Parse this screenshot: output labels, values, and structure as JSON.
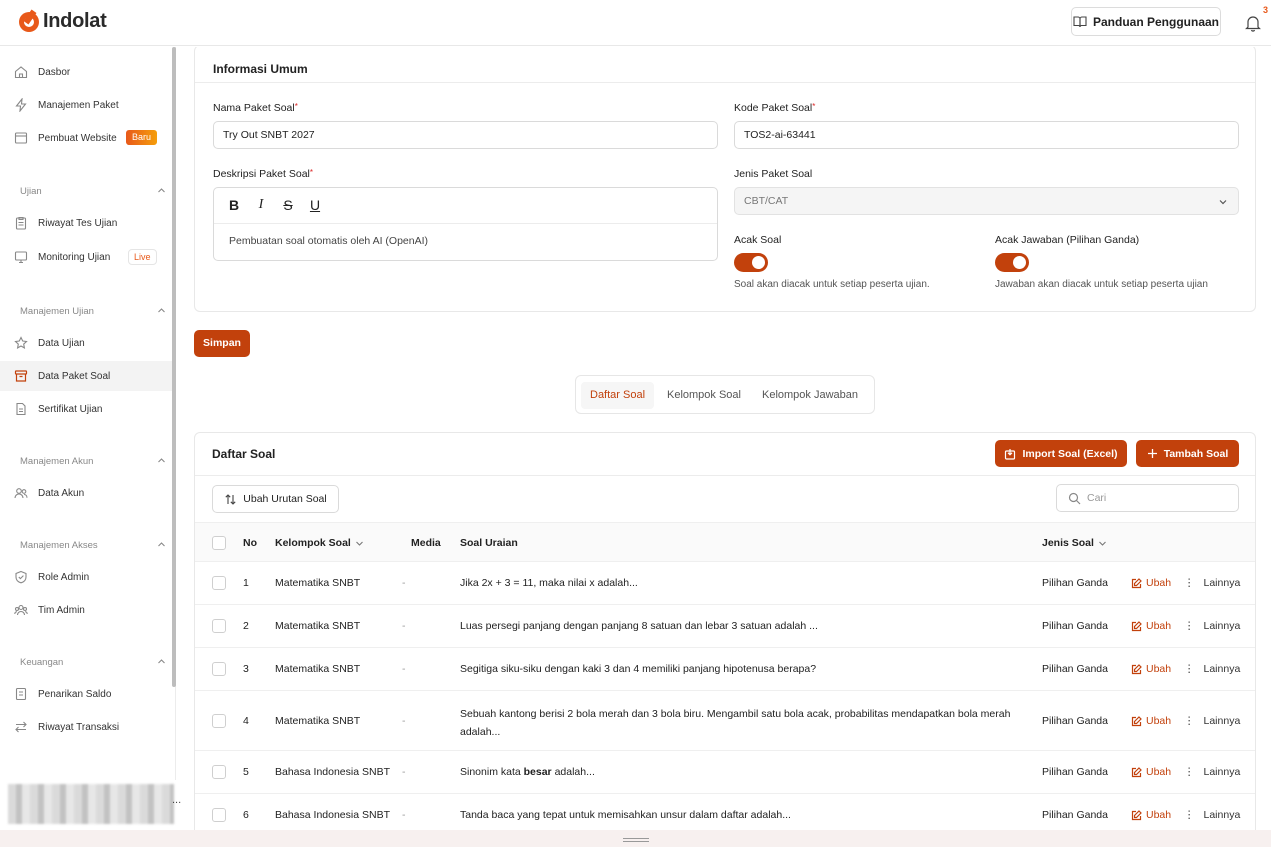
{
  "app": {
    "name": "Indolat"
  },
  "header": {
    "guide_label": "Panduan Penggunaan",
    "notification_count": "3"
  },
  "sidebar": {
    "items": [
      {
        "label": "Dasbor"
      },
      {
        "label": "Manajemen Paket"
      },
      {
        "label": "Pembuat Website",
        "badge": "Baru"
      }
    ],
    "sections": [
      {
        "title": "Ujian",
        "items": [
          {
            "label": "Riwayat Tes Ujian"
          },
          {
            "label": "Monitoring Ujian",
            "badge": "Live"
          }
        ]
      },
      {
        "title": "Manajemen Ujian",
        "items": [
          {
            "label": "Data Ujian"
          },
          {
            "label": "Data Paket Soal"
          },
          {
            "label": "Sertifikat Ujian"
          }
        ]
      },
      {
        "title": "Manajemen Akun",
        "items": [
          {
            "label": "Data Akun"
          }
        ]
      },
      {
        "title": "Manajemen Akses",
        "items": [
          {
            "label": "Role Admin"
          },
          {
            "label": "Tim Admin"
          }
        ]
      },
      {
        "title": "Keuangan",
        "items": [
          {
            "label": "Penarikan Saldo"
          },
          {
            "label": "Riwayat Transaksi"
          }
        ]
      }
    ],
    "active_item": "Data Paket Soal",
    "user_more": "..."
  },
  "form": {
    "title": "Informasi Umum",
    "nama_label": "Nama Paket Soal",
    "nama_value": "Try Out SNBT 2027",
    "kode_label": "Kode Paket Soal",
    "kode_value": "TOS2-ai-63441",
    "deskripsi_label": "Deskripsi Paket Soal",
    "deskripsi_value": "Pembuatan soal otomatis oleh AI (OpenAI)",
    "jenis_label": "Jenis Paket Soal",
    "jenis_value": "CBT/CAT",
    "acak_soal_label": "Acak Soal",
    "acak_soal_on": true,
    "acak_soal_hint": "Soal akan diacak untuk setiap peserta ujian.",
    "acak_jawaban_label": "Acak Jawaban (Pilihan Ganda)",
    "acak_jawaban_on": true,
    "acak_jawaban_hint": "Jawaban akan diacak untuk setiap peserta ujian",
    "required_mark": "*",
    "save_label": "Simpan"
  },
  "tabs": [
    {
      "label": "Daftar Soal",
      "active": true
    },
    {
      "label": "Kelompok Soal",
      "active": false
    },
    {
      "label": "Kelompok Jawaban",
      "active": false
    }
  ],
  "question_list": {
    "title": "Daftar Soal",
    "import_label": "Import Soal (Excel)",
    "add_label": "Tambah Soal",
    "reorder_label": "Ubah Urutan Soal",
    "search_placeholder": "Cari",
    "columns": {
      "no": "No",
      "group": "Kelompok Soal",
      "media": "Media",
      "question": "Soal Uraian",
      "type": "Jenis Soal"
    },
    "edit_label": "Ubah",
    "more_label": "Lainnya",
    "rows": [
      {
        "no": "1",
        "group": "Matematika SNBT",
        "media": "-",
        "question": "Jika 2x + 3 = 11, maka nilai x adalah...",
        "type": "Pilihan Ganda"
      },
      {
        "no": "2",
        "group": "Matematika SNBT",
        "media": "-",
        "question": "Luas persegi panjang dengan panjang 8 satuan dan lebar 3 satuan adalah ...",
        "type": "Pilihan Ganda"
      },
      {
        "no": "3",
        "group": "Matematika SNBT",
        "media": "-",
        "question": "Segitiga siku-siku dengan kaki 3 dan 4 memiliki panjang hipotenusa berapa?",
        "type": "Pilihan Ganda"
      },
      {
        "no": "4",
        "group": "Matematika SNBT",
        "media": "-",
        "question": "Sebuah kantong berisi 2 bola merah dan 3 bola biru. Mengambil satu bola acak, probabilitas mendapatkan bola merah adalah...",
        "type": "Pilihan Ganda"
      },
      {
        "no": "5",
        "group": "Bahasa Indonesia SNBT",
        "media": "-",
        "question_pre": "Sinonim kata ",
        "question_bold": "besar",
        "question_post": " adalah...",
        "type": "Pilihan Ganda"
      },
      {
        "no": "6",
        "group": "Bahasa Indonesia SNBT",
        "media": "-",
        "question": "Tanda baca yang tepat untuk memisahkan unsur dalam daftar adalah...",
        "type": "Pilihan Ganda"
      }
    ]
  },
  "colors": {
    "brand": "#c2410c",
    "logo": "#e8591a",
    "required": "#dc2626"
  }
}
